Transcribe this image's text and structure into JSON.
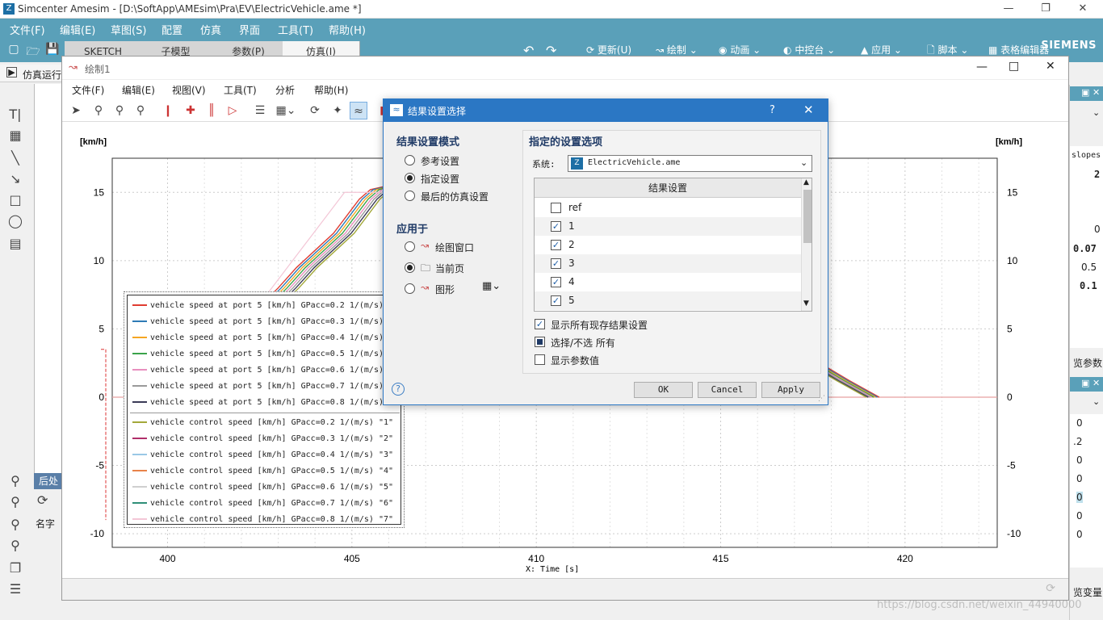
{
  "app": {
    "title": "Simcenter Amesim",
    "path": "[D:\\SoftApp\\AMEsim\\Pra\\EV\\ElectricVehicle.ame *]",
    "brand": "SIEMENS",
    "accent": "#5aa0b9"
  },
  "menubar": {
    "items": [
      "文件(F)",
      "编辑(E)",
      "草图(S)",
      "配置",
      "仿真",
      "界面",
      "工具(T)",
      "帮助(H)"
    ]
  },
  "mode_tabs": [
    "SKETCH",
    "子模型",
    "参数(P)",
    "仿真(I)"
  ],
  "right_tools": [
    "更新(U)",
    "绘制",
    "动画",
    "中控台",
    "应用",
    "脚本",
    "表格编辑器"
  ],
  "left": {
    "sim_run": "仿真运行",
    "post": "后处",
    "name_label": "名字"
  },
  "plot_window": {
    "title": "绘制1",
    "menu": [
      "文件(F)",
      "编辑(E)",
      "视图(V)",
      "工具(T)",
      "分析",
      "帮助(H)"
    ],
    "y_unit_left": "[km/h]",
    "y_unit_right": "[km/h]",
    "x_label": "X: Time [s]"
  },
  "chart_data": {
    "type": "line",
    "xlabel": "X: Time [s]",
    "ylabel": "[km/h]",
    "xlim": [
      398.5,
      422.5
    ],
    "ylim": [
      -11,
      17.5
    ],
    "x_ticks": [
      400,
      405,
      410,
      415,
      420
    ],
    "y_ticks": [
      15,
      10,
      5,
      0,
      -5,
      -10
    ],
    "grid": true,
    "legend_position": "bottom-left",
    "legend": [
      {
        "label": "vehicle speed at port 5 [km/h] GPacc=0.2 1/(m/s)",
        "color": "#e03c31"
      },
      {
        "label": "vehicle speed at port 5 [km/h] GPacc=0.3 1/(m/s)",
        "color": "#2e7bb5"
      },
      {
        "label": "vehicle speed at port 5 [km/h] GPacc=0.4 1/(m/s)",
        "color": "#f5a623"
      },
      {
        "label": "vehicle speed at port 5 [km/h] GPacc=0.5 1/(m/s)",
        "color": "#3aa34a"
      },
      {
        "label": "vehicle speed at port 5 [km/h] GPacc=0.6 1/(m/s)",
        "color": "#e88fbf"
      },
      {
        "label": "vehicle speed at port 5 [km/h] GPacc=0.7 1/(m/s)",
        "color": "#9a9a9a"
      },
      {
        "label": "vehicle speed at port 5 [km/h] GPacc=0.8 1/(m/s)",
        "color": "#3b3b57"
      },
      {
        "label": "vehicle control speed [km/h] GPacc=0.2 1/(m/s) \"1\"",
        "color": "#a3a83a"
      },
      {
        "label": "vehicle control speed [km/h] GPacc=0.3 1/(m/s) \"2\"",
        "color": "#b02f6a"
      },
      {
        "label": "vehicle control speed [km/h] GPacc=0.4 1/(m/s) \"3\"",
        "color": "#9ac8e6"
      },
      {
        "label": "vehicle control speed [km/h] GPacc=0.5 1/(m/s) \"4\"",
        "color": "#e8834a"
      },
      {
        "label": "vehicle control speed [km/h] GPacc=0.6 1/(m/s) \"5\"",
        "color": "#cfcfcf"
      },
      {
        "label": "vehicle control speed [km/h] GPacc=0.7 1/(m/s) \"6\"",
        "color": "#2f8f78"
      },
      {
        "label": "vehicle control speed [km/h] GPacc=0.8 1/(m/s) \"7\"",
        "color": "#f3c6d6"
      }
    ],
    "series_visible_fragments": [
      {
        "x": [
          401.5,
          403.0,
          403.5,
          404.5,
          405.2,
          405.5,
          406.0
        ],
        "y": [
          4,
          8,
          9.5,
          12,
          14.5,
          15.2,
          15.5
        ]
      },
      {
        "x": [
          416.5,
          417.5,
          418.5,
          419.3
        ],
        "y": [
          4.5,
          2.8,
          1.2,
          0
        ]
      }
    ]
  },
  "dialog": {
    "title": "结果设置选择",
    "help": "?",
    "mode_title": "结果设置模式",
    "modes": [
      {
        "label": "参考设置",
        "selected": false
      },
      {
        "label": "指定设置",
        "selected": true
      },
      {
        "label": "最后的仿真设置",
        "selected": false
      }
    ],
    "apply_title": "应用于",
    "apply_to": [
      {
        "label": "绘图窗口",
        "selected": false
      },
      {
        "label": "当前页",
        "selected": true
      },
      {
        "label": "图形",
        "selected": false
      }
    ],
    "options_title": "指定的设置选项",
    "system_label": "系统:",
    "system_value": "ElectricVehicle.ame",
    "table_header": "结果设置",
    "result_sets": [
      {
        "label": "ref",
        "checked": false
      },
      {
        "label": "1",
        "checked": true
      },
      {
        "label": "2",
        "checked": true
      },
      {
        "label": "3",
        "checked": true
      },
      {
        "label": "4",
        "checked": true
      },
      {
        "label": "5",
        "checked": true
      }
    ],
    "show_all": {
      "label": "显示所有现存结果设置",
      "checked": true
    },
    "select_all": {
      "label": "选择/不选 所有",
      "partial": true
    },
    "show_params": {
      "label": "显示参数值",
      "checked": false
    },
    "buttons": {
      "ok": "OK",
      "cancel": "Cancel",
      "apply": "Apply"
    }
  },
  "right_panel": {
    "slopes_label": "slopes",
    "values": [
      "2",
      "0",
      "0.07",
      "0.5",
      "0.1"
    ],
    "label_params": "览参数",
    "label_vars": "览变量",
    "lower_values": [
      "0",
      ".2",
      "0",
      "0",
      "0",
      "0",
      "0"
    ]
  },
  "watermark": "https://blog.csdn.net/weixin_44940000"
}
